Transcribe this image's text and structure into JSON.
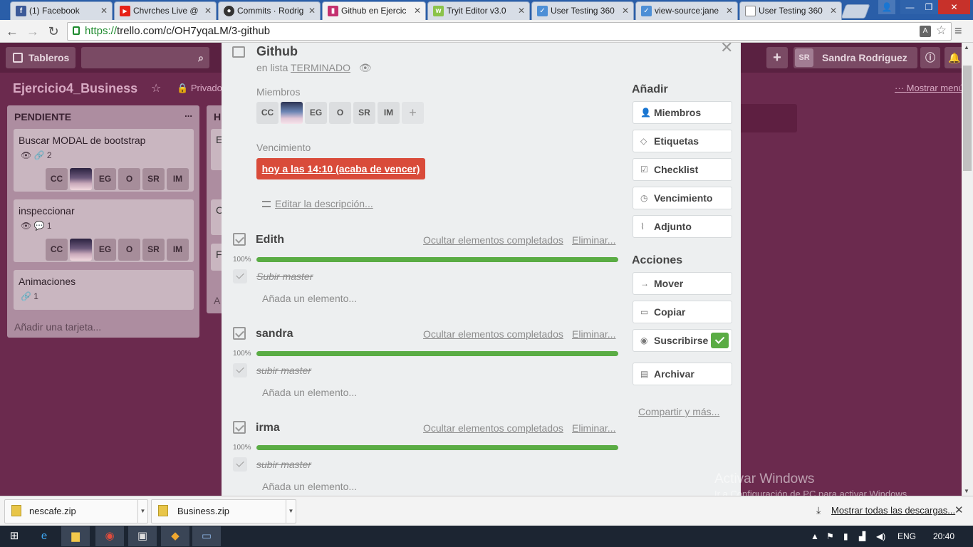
{
  "browser": {
    "tabs": [
      {
        "title": "(1) Facebook",
        "icon": "facebook-icon",
        "color": "#3b5998",
        "glyph": "f"
      },
      {
        "title": "Chvrches Live @",
        "icon": "youtube-icon",
        "color": "#e62117",
        "glyph": "▶"
      },
      {
        "title": "Commits · Rodrig",
        "icon": "github-icon",
        "color": "#333333",
        "glyph": "●"
      },
      {
        "title": "Github en Ejercic",
        "icon": "trello-icon",
        "color": "#c4316f",
        "glyph": "▮"
      },
      {
        "title": "Tryit Editor v3.0",
        "icon": "w3schools-icon",
        "color": "#8bc34a",
        "glyph": "w"
      },
      {
        "title": "User Testing 360",
        "icon": "checkbox-icon",
        "color": "#4d8fd6",
        "glyph": "✓"
      },
      {
        "title": "view-source:jane",
        "icon": "checkbox-icon",
        "color": "#4d8fd6",
        "glyph": "✓"
      },
      {
        "title": "User Testing 360",
        "icon": "page-icon",
        "color": "#888888",
        "glyph": "▯"
      }
    ],
    "url_scheme": "https://",
    "url_rest": "trello.com/c/OH7yqaLM/3-github"
  },
  "trello": {
    "boards_label": "Tableros",
    "user_initials": "SR",
    "user_name": "Sandra Rodriguez",
    "board_title": "Ejercicio4_Business",
    "privacy": "Privado",
    "show_menu": "Mostrar menú",
    "lists": [
      {
        "title": "PENDIENTE",
        "dots": "...",
        "add_card": "Añadir una tarjeta...",
        "cards": [
          {
            "title": "Buscar MODAL de bootstrap",
            "badge": "👁   🔗 2"
          },
          {
            "title": "inspeccionar",
            "badge": "👁   💬 1"
          },
          {
            "title": "Animaciones",
            "badge": "🔗 1"
          }
        ]
      },
      {
        "title": "H",
        "partial_items": [
          "E",
          "C",
          "F",
          "A"
        ]
      }
    ],
    "card_avatars": [
      "CC",
      "",
      "EG",
      "O",
      "SR",
      "IM"
    ]
  },
  "card": {
    "title": "Github",
    "in_list_prefix": "en lista",
    "list_name": "TERMINADO",
    "members_label": "Miembros",
    "members": [
      "CC",
      "",
      "EG",
      "O",
      "SR",
      "IM"
    ],
    "add_member": "+",
    "due_label": "Vencimiento",
    "due_value": "hoy a las 14:10 (acaba de vencer)",
    "edit_description": "Editar la descripción...",
    "checklists": [
      {
        "title": "Edith",
        "percent": "100%",
        "progress": 100,
        "hide": "Ocultar elementos completados",
        "delete": "Eliminar...",
        "items": [
          "Subir master"
        ],
        "add_item": "Añada un elemento..."
      },
      {
        "title": "sandra",
        "percent": "100%",
        "progress": 100,
        "hide": "Ocultar elementos completados",
        "delete": "Eliminar...",
        "items": [
          "subir master"
        ],
        "add_item": "Añada un elemento..."
      },
      {
        "title": "irma",
        "percent": "100%",
        "progress": 100,
        "hide": "Ocultar elementos completados",
        "delete": "Eliminar...",
        "items": [
          "subir master"
        ],
        "add_item": "Añada un elemento..."
      }
    ],
    "sidebar": {
      "add_heading": "Añadir",
      "add_buttons": [
        {
          "label": "Miembros",
          "icon": "person-icon"
        },
        {
          "label": "Etiquetas",
          "icon": "tag-icon"
        },
        {
          "label": "Checklist",
          "icon": "checklist-icon"
        },
        {
          "label": "Vencimiento",
          "icon": "clock-icon"
        },
        {
          "label": "Adjunto",
          "icon": "paperclip-icon"
        }
      ],
      "actions_heading": "Acciones",
      "action_buttons": [
        {
          "label": "Mover",
          "icon": "arrow-right-icon"
        },
        {
          "label": "Copiar",
          "icon": "copy-icon"
        },
        {
          "label": "Suscribirse",
          "icon": "eye-icon"
        },
        {
          "label": "Archivar",
          "icon": "archive-icon"
        }
      ],
      "share": "Compartir y más..."
    }
  },
  "windows_watermark": {
    "line1": "Activar Windows",
    "line2": "Ir a Configuración de PC para activar Windows."
  },
  "downloads": {
    "files": [
      "nescafe.zip",
      "Business.zip"
    ],
    "show_all": "Mostrar todas las descargas..."
  },
  "taskbar": {
    "language": "ENG",
    "time": "20:40"
  },
  "colors": {
    "trello_board": "#6b2a4e",
    "due_overdue": "#d94b3a",
    "progress_complete": "#5aac44"
  }
}
